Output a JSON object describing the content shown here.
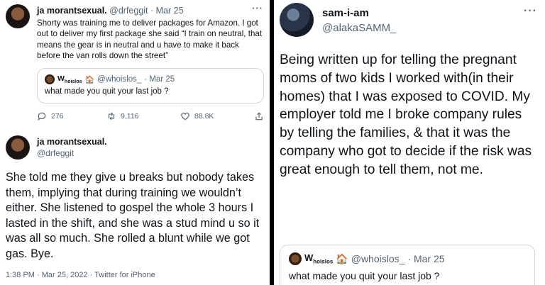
{
  "left": {
    "tweet1": {
      "display_name": "ja morantsexual.",
      "handle": "@drfeggit",
      "date": "· Mar 25",
      "more": "···",
      "text": "Shorty was training me to deliver packages for Amazon. I got out to deliver my first package she said “I train on neutral, that means the gear is in neutral and u have to make it back before the van rolls down the street”",
      "quote": {
        "name_main": "W",
        "name_sub": "hoislos",
        "emoji_house": "🏠",
        "handle": "@whoislos_",
        "date": "· Mar 25",
        "text": "what made you quit your last job ?"
      },
      "actions": {
        "replies": "276",
        "retweets": "9,116",
        "likes": "88.8K"
      }
    },
    "tweet2": {
      "display_name": "ja morantsexual.",
      "handle": "@drfeggit",
      "text": "She told me they give u breaks but nobody takes them, implying that during training we wouldn’t either. She listened to gospel the whole 3 hours I lasted in the shift, and she was a stud mind u so it was all so much. She rolled a blunt while we got gas. Bye.",
      "meta": "1:38 PM · Mar 25, 2022 · Twitter for iPhone"
    }
  },
  "right": {
    "display_name": "sam-i-am",
    "handle": "@alakaSAMM_",
    "more": "···",
    "text": "Being written up for telling the pregnant moms of two kids I worked with(in their homes) that I was exposed to COVID. My employer told me I broke company rules by telling the families, & that it was the company who got to decide if the risk was great enough to tell them, not me.",
    "quote": {
      "name_main": "W",
      "name_sub": "hoislos",
      "emoji_house": "🏠",
      "handle": "@whoislos_",
      "date": "· Mar 25",
      "text": "what made you quit your last job ?"
    }
  },
  "icons": {
    "reply": "reply-icon",
    "retweet": "retweet-icon",
    "like": "heart-icon",
    "share": "share-icon"
  },
  "colors": {
    "text": "#0f1419",
    "secondary": "#536471",
    "border": "#cfd9de",
    "divider": "#000000"
  }
}
